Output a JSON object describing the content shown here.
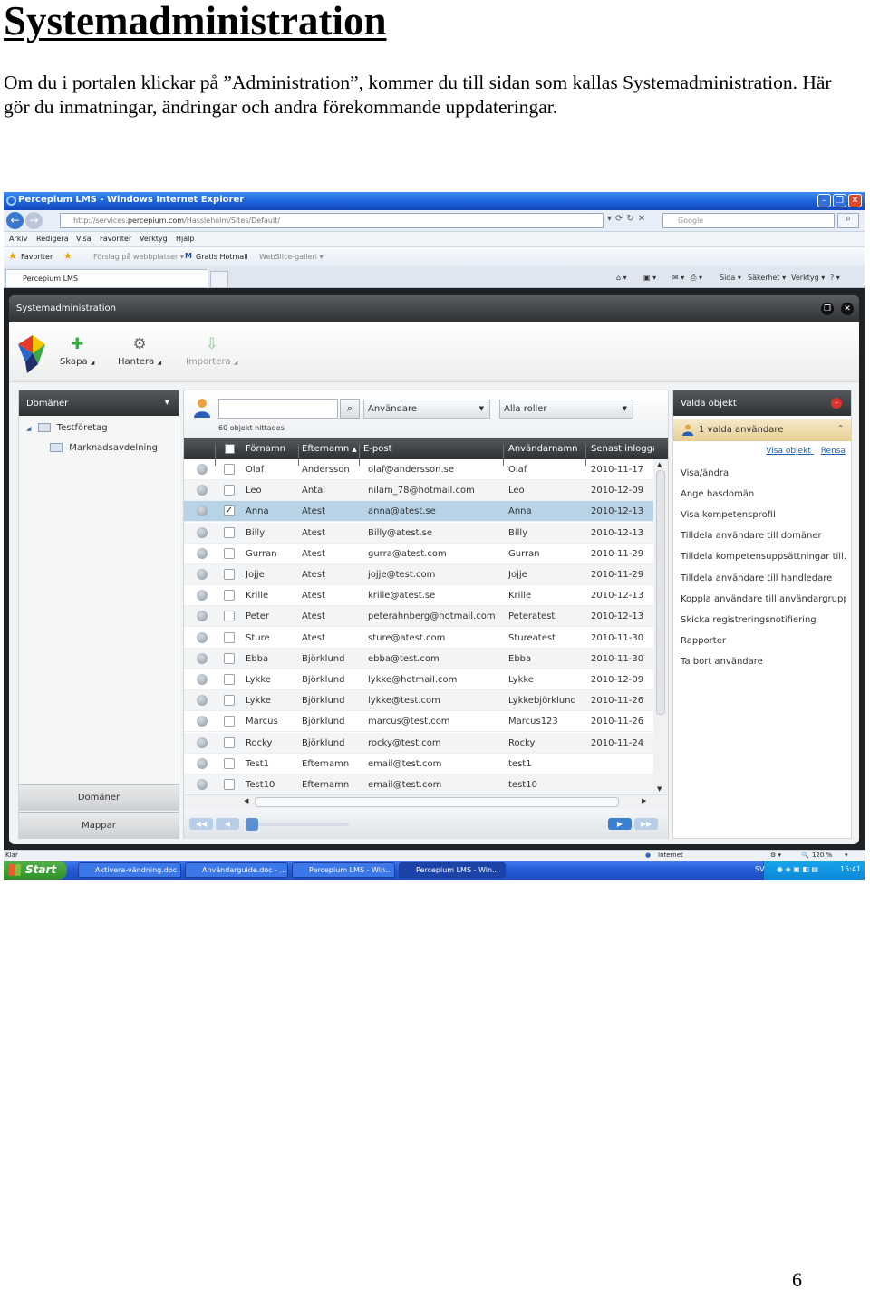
{
  "document": {
    "heading": "Systemadministration",
    "paragraph": "Om du i portalen klickar på ”Administration”, kommer du till sidan som kallas Systemadministration. Här gör du inmatningar, ändringar och andra förekommande uppdateringar.",
    "page_number": "6"
  },
  "browser": {
    "window_title": "Percepium LMS - Windows Internet Explorer",
    "address_prefix": "http://services.",
    "address_host": "percepium.com",
    "address_path": "/Hassleholm/Sites/Default/",
    "search_placeholder": "Google",
    "menu": [
      "Arkiv",
      "Redigera",
      "Visa",
      "Favoriter",
      "Verktyg",
      "Hjälp"
    ],
    "favorites_label": "Favoriter",
    "favorites_items": [
      "Förslag på webbplatser ▾",
      "Gratis Hotmail",
      "WebSlice-galleri ▾"
    ],
    "tab_label": "Percepium LMS",
    "command_items": [
      "Sida ▾",
      "Säkerhet ▾",
      "Verktyg ▾"
    ],
    "status_left": "Klar",
    "status_zone": "Internet",
    "zoom": "120 %"
  },
  "app": {
    "title": "Systemadministration",
    "toolbar": {
      "create": "Skapa",
      "manage": "Hantera",
      "import": "Importera"
    },
    "left": {
      "header": "Domäner",
      "tree_root": "Testföretag",
      "tree_child": "Marknadsavdelning",
      "btn_domains": "Domäner",
      "btn_folders": "Mappar"
    },
    "search": {
      "type_dropdown": "Användare",
      "role_dropdown": "Alla roller",
      "hits": "60 objekt hittades"
    },
    "grid": {
      "columns": [
        "Förnamn",
        "Efternamn",
        "E-post",
        "Användarnamn",
        "Senast inloggad"
      ],
      "rows": [
        {
          "first": "Olaf",
          "last": "Andersson",
          "email": "olaf@andersson.se",
          "user": "Olaf",
          "last_login": "2010-11-17"
        },
        {
          "first": "Leo",
          "last": "Antal",
          "email": "nilam_78@hotmail.com",
          "user": "Leo",
          "last_login": "2010-12-09"
        },
        {
          "first": "Anna",
          "last": "Atest",
          "email": "anna@atest.se",
          "user": "Anna",
          "last_login": "2010-12-13"
        },
        {
          "first": "Billy",
          "last": "Atest",
          "email": "Billy@atest.se",
          "user": "Billy",
          "last_login": "2010-12-13"
        },
        {
          "first": "Gurran",
          "last": "Atest",
          "email": "gurra@atest.com",
          "user": "Gurran",
          "last_login": "2010-11-29"
        },
        {
          "first": "Jojje",
          "last": "Atest",
          "email": "jojje@test.com",
          "user": "Jojje",
          "last_login": "2010-11-29"
        },
        {
          "first": "Krille",
          "last": "Atest",
          "email": "krille@atest.se",
          "user": "Krille",
          "last_login": "2010-12-13"
        },
        {
          "first": "Peter",
          "last": "Atest",
          "email": "peterahnberg@hotmail.com",
          "user": "Peteratest",
          "last_login": "2010-12-13"
        },
        {
          "first": "Sture",
          "last": "Atest",
          "email": "sture@atest.com",
          "user": "Stureatest",
          "last_login": "2010-11-30"
        },
        {
          "first": "Ebba",
          "last": "Björklund",
          "email": "ebba@test.com",
          "user": "Ebba",
          "last_login": "2010-11-30"
        },
        {
          "first": "Lykke",
          "last": "Björklund",
          "email": "lykke@hotmail.com",
          "user": "Lykke",
          "last_login": "2010-12-09"
        },
        {
          "first": "Lykke",
          "last": "Björklund",
          "email": "lykke@test.com",
          "user": "Lykkebjörklund",
          "last_login": "2010-11-26"
        },
        {
          "first": "Marcus",
          "last": "Björklund",
          "email": "marcus@test.com",
          "user": "Marcus123",
          "last_login": "2010-11-26"
        },
        {
          "first": "Rocky",
          "last": "Björklund",
          "email": "rocky@test.com",
          "user": "Rocky",
          "last_login": "2010-11-24"
        },
        {
          "first": "Test1",
          "last": "Efternamn",
          "email": "email@test.com",
          "user": "test1",
          "last_login": ""
        },
        {
          "first": "Test10",
          "last": "Efternamn",
          "email": "email@test.com",
          "user": "test10",
          "last_login": ""
        }
      ],
      "selected_index": 2
    },
    "right": {
      "header": "Valda objekt",
      "selection": "1 valda användare",
      "link_show": "Visa objekt",
      "link_clear": "Rensa",
      "actions": [
        "Visa/ändra",
        "Ange basdomän",
        "Visa kompetensprofil",
        "Tilldela användare till domäner",
        "Tilldela kompetensuppsättningar till...",
        "Tilldela användare till handledare",
        "Koppla användare till användargrupp...",
        "Skicka registreringsnotifiering",
        "Rapporter",
        "Ta bort användare"
      ]
    }
  },
  "taskbar": {
    "start": "Start",
    "tasks": [
      "Aktivera-vändning.doc ...",
      "Användarguide.doc - ...",
      "Percepium LMS - Win...",
      "Percepium LMS - Win..."
    ],
    "lang": "SV",
    "clock": "15:41"
  }
}
